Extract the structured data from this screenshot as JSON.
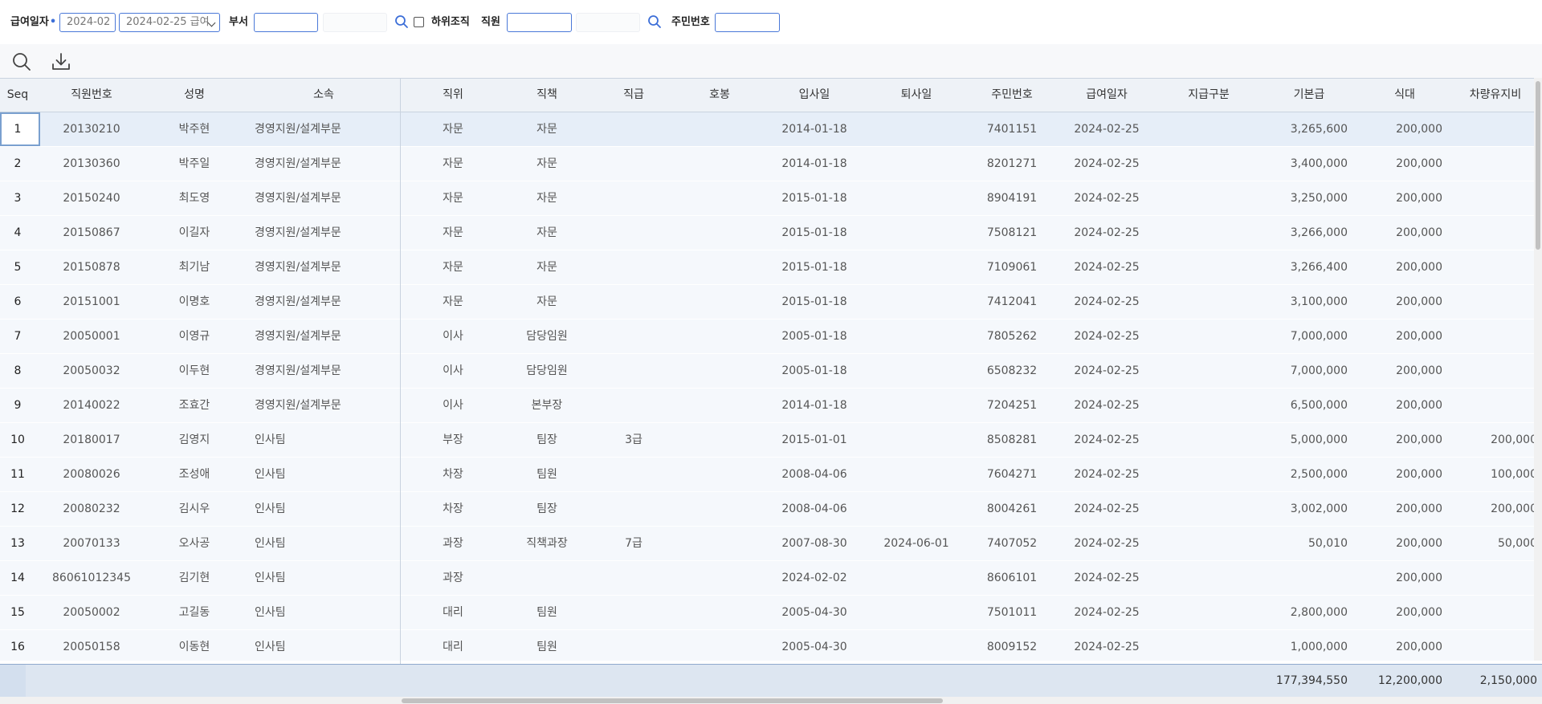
{
  "filters": {
    "pay_date_label": "급여일자",
    "pay_date_required_mark": "•",
    "pay_month_value": "2024-02",
    "pay_date_select_value": "2024-02-25 급여",
    "dept_label": "부서",
    "dept_code_value": "",
    "dept_name_value": "",
    "sub_org_label": "하위조직",
    "employee_label": "직원",
    "employee_code_value": "",
    "employee_name_value": "",
    "resident_no_label": "주민번호",
    "resident_no_value": ""
  },
  "toolbar": {
    "icons": [
      "search-icon",
      "download-icon"
    ]
  },
  "grid": {
    "columns": {
      "seq": "Seq",
      "emp_no": "직원번호",
      "name": "성명",
      "dept": "소속",
      "position": "직위",
      "duty": "직책",
      "grade": "직급",
      "step": "호봉",
      "hire_date": "입사일",
      "leave_date": "퇴사일",
      "resident_no": "주민번호",
      "pay_date": "급여일자",
      "pay_type": "지급구분",
      "base_pay": "기본급",
      "meal": "식대",
      "car": "차량유지비"
    },
    "rows": [
      {
        "seq": "1",
        "emp_no": "20130210",
        "name": "박주현",
        "dept": "경영지원/설계부문",
        "position": "자문",
        "duty": "자문",
        "grade": "",
        "step": "",
        "hire_date": "2014-01-18",
        "leave_date": "",
        "resident_no": "7401151",
        "pay_date": "2024-02-25",
        "pay_type": "",
        "base_pay": "3,265,600",
        "meal": "200,000",
        "car": ""
      },
      {
        "seq": "2",
        "emp_no": "20130360",
        "name": "박주일",
        "dept": "경영지원/설계부문",
        "position": "자문",
        "duty": "자문",
        "grade": "",
        "step": "",
        "hire_date": "2014-01-18",
        "leave_date": "",
        "resident_no": "8201271",
        "pay_date": "2024-02-25",
        "pay_type": "",
        "base_pay": "3,400,000",
        "meal": "200,000",
        "car": ""
      },
      {
        "seq": "3",
        "emp_no": "20150240",
        "name": "최도영",
        "dept": "경영지원/설계부문",
        "position": "자문",
        "duty": "자문",
        "grade": "",
        "step": "",
        "hire_date": "2015-01-18",
        "leave_date": "",
        "resident_no": "8904191",
        "pay_date": "2024-02-25",
        "pay_type": "",
        "base_pay": "3,250,000",
        "meal": "200,000",
        "car": ""
      },
      {
        "seq": "4",
        "emp_no": "20150867",
        "name": "이길자",
        "dept": "경영지원/설계부문",
        "position": "자문",
        "duty": "자문",
        "grade": "",
        "step": "",
        "hire_date": "2015-01-18",
        "leave_date": "",
        "resident_no": "7508121",
        "pay_date": "2024-02-25",
        "pay_type": "",
        "base_pay": "3,266,000",
        "meal": "200,000",
        "car": ""
      },
      {
        "seq": "5",
        "emp_no": "20150878",
        "name": "최기남",
        "dept": "경영지원/설계부문",
        "position": "자문",
        "duty": "자문",
        "grade": "",
        "step": "",
        "hire_date": "2015-01-18",
        "leave_date": "",
        "resident_no": "7109061",
        "pay_date": "2024-02-25",
        "pay_type": "",
        "base_pay": "3,266,400",
        "meal": "200,000",
        "car": ""
      },
      {
        "seq": "6",
        "emp_no": "20151001",
        "name": "이명호",
        "dept": "경영지원/설계부문",
        "position": "자문",
        "duty": "자문",
        "grade": "",
        "step": "",
        "hire_date": "2015-01-18",
        "leave_date": "",
        "resident_no": "7412041",
        "pay_date": "2024-02-25",
        "pay_type": "",
        "base_pay": "3,100,000",
        "meal": "200,000",
        "car": ""
      },
      {
        "seq": "7",
        "emp_no": "20050001",
        "name": "이영규",
        "dept": "경영지원/설계부문",
        "position": "이사",
        "duty": "담당임원",
        "grade": "",
        "step": "",
        "hire_date": "2005-01-18",
        "leave_date": "",
        "resident_no": "7805262",
        "pay_date": "2024-02-25",
        "pay_type": "",
        "base_pay": "7,000,000",
        "meal": "200,000",
        "car": ""
      },
      {
        "seq": "8",
        "emp_no": "20050032",
        "name": "이두현",
        "dept": "경영지원/설계부문",
        "position": "이사",
        "duty": "담당임원",
        "grade": "",
        "step": "",
        "hire_date": "2005-01-18",
        "leave_date": "",
        "resident_no": "6508232",
        "pay_date": "2024-02-25",
        "pay_type": "",
        "base_pay": "7,000,000",
        "meal": "200,000",
        "car": ""
      },
      {
        "seq": "9",
        "emp_no": "20140022",
        "name": "조효간",
        "dept": "경영지원/설계부문",
        "position": "이사",
        "duty": "본부장",
        "grade": "",
        "step": "",
        "hire_date": "2014-01-18",
        "leave_date": "",
        "resident_no": "7204251",
        "pay_date": "2024-02-25",
        "pay_type": "",
        "base_pay": "6,500,000",
        "meal": "200,000",
        "car": ""
      },
      {
        "seq": "10",
        "emp_no": "20180017",
        "name": "김영지",
        "dept": "인사팀",
        "position": "부장",
        "duty": "팀장",
        "grade": "3급",
        "step": "",
        "hire_date": "2015-01-01",
        "leave_date": "",
        "resident_no": "8508281",
        "pay_date": "2024-02-25",
        "pay_type": "",
        "base_pay": "5,000,000",
        "meal": "200,000",
        "car": "200,000"
      },
      {
        "seq": "11",
        "emp_no": "20080026",
        "name": "조성애",
        "dept": "인사팀",
        "position": "차장",
        "duty": "팀원",
        "grade": "",
        "step": "",
        "hire_date": "2008-04-06",
        "leave_date": "",
        "resident_no": "7604271",
        "pay_date": "2024-02-25",
        "pay_type": "",
        "base_pay": "2,500,000",
        "meal": "200,000",
        "car": "100,000"
      },
      {
        "seq": "12",
        "emp_no": "20080232",
        "name": "김시우",
        "dept": "인사팀",
        "position": "차장",
        "duty": "팀장",
        "grade": "",
        "step": "",
        "hire_date": "2008-04-06",
        "leave_date": "",
        "resident_no": "8004261",
        "pay_date": "2024-02-25",
        "pay_type": "",
        "base_pay": "3,002,000",
        "meal": "200,000",
        "car": "200,000"
      },
      {
        "seq": "13",
        "emp_no": "20070133",
        "name": "오사공",
        "dept": "인사팀",
        "position": "과장",
        "duty": "직책과장",
        "grade": "7급",
        "step": "",
        "hire_date": "2007-08-30",
        "leave_date": "2024-06-01",
        "resident_no": "7407052",
        "pay_date": "2024-02-25",
        "pay_type": "",
        "base_pay": "50,010",
        "meal": "200,000",
        "car": "50,000"
      },
      {
        "seq": "14",
        "emp_no": "86061012345",
        "name": "김기현",
        "dept": "인사팀",
        "position": "과장",
        "duty": "",
        "grade": "",
        "step": "",
        "hire_date": "2024-02-02",
        "leave_date": "",
        "resident_no": "8606101",
        "pay_date": "2024-02-25",
        "pay_type": "",
        "base_pay": "",
        "meal": "200,000",
        "car": ""
      },
      {
        "seq": "15",
        "emp_no": "20050002",
        "name": "고길동",
        "dept": "인사팀",
        "position": "대리",
        "duty": "팀원",
        "grade": "",
        "step": "",
        "hire_date": "2005-04-30",
        "leave_date": "",
        "resident_no": "7501011",
        "pay_date": "2024-02-25",
        "pay_type": "",
        "base_pay": "2,800,000",
        "meal": "200,000",
        "car": ""
      },
      {
        "seq": "16",
        "emp_no": "20050158",
        "name": "이동현",
        "dept": "인사팀",
        "position": "대리",
        "duty": "팀원",
        "grade": "",
        "step": "",
        "hire_date": "2005-04-30",
        "leave_date": "",
        "resident_no": "8009152",
        "pay_date": "2024-02-25",
        "pay_type": "",
        "base_pay": "1,000,000",
        "meal": "200,000",
        "car": ""
      }
    ],
    "totals": {
      "base_pay": "177,394,550",
      "meal": "12,200,000",
      "car": "2,150,000"
    }
  }
}
